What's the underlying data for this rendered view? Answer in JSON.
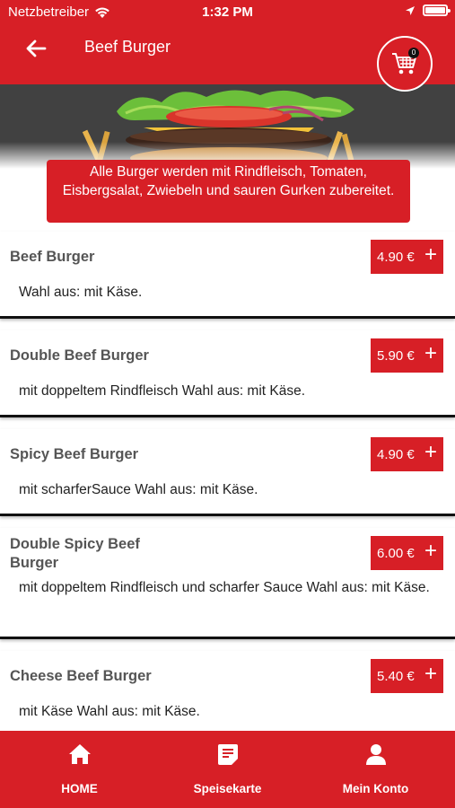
{
  "status_bar": {
    "carrier": "Netzbetreiber",
    "time": "1:32 PM"
  },
  "header": {
    "title": "Beef Burger",
    "cart_count": "0"
  },
  "notice": {
    "text": "Alle Burger werden mit Rindfleisch, Tomaten, Eisbergsalat, Zwiebeln und sauren Gurken zubereitet."
  },
  "items": [
    {
      "name": "Beef Burger",
      "description": "Wahl aus: mit Käse.",
      "price": "4.90 €"
    },
    {
      "name": "Double Beef Burger",
      "description": "mit doppeltem Rindfleisch Wahl aus: mit Käse.",
      "price": "5.90 €"
    },
    {
      "name": "Spicy Beef Burger",
      "description": "mit scharferSauce Wahl aus: mit Käse.",
      "price": "4.90 €"
    },
    {
      "name": "Double Spicy Beef Burger",
      "description": "mit doppeltem Rindfleisch und scharfer Sauce Wahl aus: mit Käse.",
      "price": "6.00 €"
    },
    {
      "name": "Cheese Beef Burger",
      "description": "mit Käse Wahl aus: mit Käse.",
      "price": "5.40 €"
    }
  ],
  "bottom_nav": [
    {
      "label": "HOME",
      "icon": "home-icon"
    },
    {
      "label": "Speisekarte",
      "icon": "menu-card-icon"
    },
    {
      "label": "Mein Konto",
      "icon": "account-icon"
    }
  ],
  "colors": {
    "brand_red": "#d71f26",
    "white": "#ffffff",
    "divider": "#111111"
  }
}
